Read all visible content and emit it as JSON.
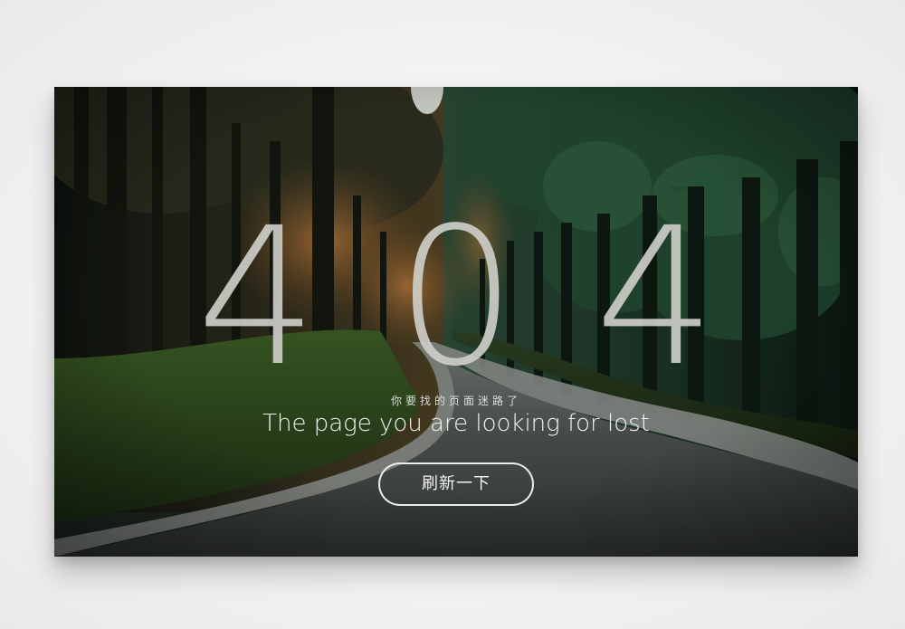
{
  "error": {
    "code_digits": [
      "4",
      "0",
      "4"
    ],
    "message_cn": "你要找的页面迷路了",
    "message_en": "The page you are looking for lost"
  },
  "actions": {
    "refresh_label": "刷新一下"
  },
  "colors": {
    "page_background": "#f2f2f2",
    "digit_color": "#cdcdc8",
    "text_color": "#f4f4f4",
    "forest_dark": "#16201a",
    "road": "#3b3f3e"
  },
  "background_scene": "forest-road-photo"
}
